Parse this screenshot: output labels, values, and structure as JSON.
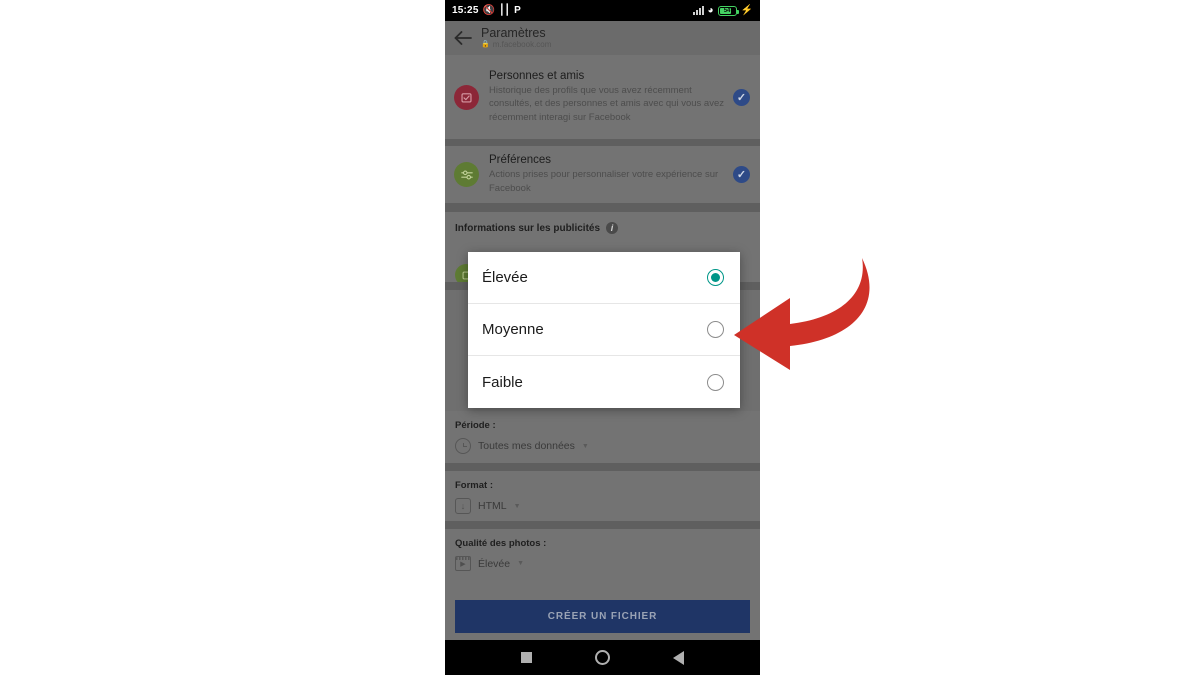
{
  "status_bar": {
    "time": "15:25",
    "icons": [
      "mute-icon",
      "vibrate-icon",
      "parking-icon"
    ],
    "signal_icon": "signal-bars-icon",
    "wifi_icon": "wifi-icon",
    "battery_level": "54",
    "charging_icon": "charging-bolt-icon"
  },
  "header": {
    "back_icon": "back-arrow-icon",
    "title": "Paramètres",
    "url": "m.facebook.com",
    "lock_icon": "lock-icon"
  },
  "content": {
    "rows": [
      {
        "icon": "people-friends-icon",
        "icon_color": "#8c2738",
        "title": "Personnes et amis",
        "description": "Historique des profils que vous avez récemment consultés, et des personnes et amis avec qui vous avez récemment interagi sur Facebook",
        "checked": true,
        "check_color": "#2e4a87"
      },
      {
        "icon": "preferences-sliders-icon",
        "icon_color": "#5e7b33",
        "title": "Préférences",
        "description": "Actions prises pour personnaliser votre expérience sur Facebook",
        "checked": true,
        "check_color": "#2e4a87"
      }
    ],
    "ads_section": {
      "label": "Informations sur les publicités",
      "info_icon": "info-icon"
    },
    "fields": [
      {
        "label": "Période :",
        "icon": "clock-icon",
        "value": "Toutes mes données",
        "caret": "▼"
      },
      {
        "label": "Format :",
        "icon": "download-folder-icon",
        "value": "HTML",
        "caret": "▼"
      },
      {
        "label": "Qualité des photos :",
        "icon": "film-icon",
        "value": "Élevée",
        "caret": "▼"
      }
    ],
    "create_button": {
      "label": "CRÉER UN FICHIER",
      "background": "#1f3566"
    }
  },
  "dialog": {
    "options": [
      {
        "label": "Élevée",
        "selected": true
      },
      {
        "label": "Moyenne",
        "selected": false
      },
      {
        "label": "Faible",
        "selected": false
      }
    ],
    "selected_color": "#009688"
  },
  "annotation": {
    "arrow": "curved-left-arrow",
    "color": "#cf3128"
  },
  "navbar": {
    "recent_icon": "recent-apps-square-icon",
    "home_icon": "home-circle-icon",
    "back_icon": "back-triangle-icon"
  }
}
